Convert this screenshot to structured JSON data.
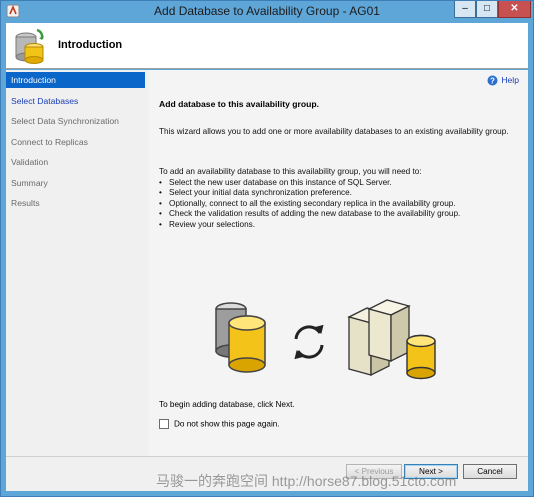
{
  "window": {
    "title": "Add Database to Availability Group - AG01",
    "minimize_glyph": "–",
    "maximize_glyph": "□",
    "close_glyph": "✕"
  },
  "header": {
    "title": "Introduction"
  },
  "nav": {
    "items": [
      {
        "label": "Introduction",
        "state": "active"
      },
      {
        "label": "Select Databases",
        "state": "link"
      },
      {
        "label": "Select Data Synchronization",
        "state": "disabled"
      },
      {
        "label": "Connect to Replicas",
        "state": "disabled"
      },
      {
        "label": "Validation",
        "state": "disabled"
      },
      {
        "label": "Summary",
        "state": "disabled"
      },
      {
        "label": "Results",
        "state": "disabled"
      }
    ]
  },
  "main": {
    "help_label": "Help",
    "heading": "Add database to this availability group.",
    "intro": "This wizard allows you to add one or more availability databases to an existing availability group.",
    "list_intro": "To add an availability database to this availability group, you will need to:",
    "steps": [
      "Select the new user database on this instance of SQL Server.",
      "Select your initial data synchronization preference.",
      "Optionally, connect to all the existing secondary replica in the availability group.",
      "Check the validation results of adding the new database to the availability group.",
      "Review your selections."
    ],
    "begin_text": "To begin adding database, click Next.",
    "checkbox_label": "Do not show this page again.",
    "checkbox_checked": false
  },
  "buttons": {
    "previous": "< Previous",
    "next": "Next >",
    "cancel": "Cancel"
  },
  "watermark": "马骏一的奔跑空间 http://horse87.blog.51cto.com",
  "colors": {
    "titlebar": "#5fa6d8",
    "nav_active": "#0a67c9",
    "link": "#1a3fb5",
    "close_button": "#c75050"
  }
}
